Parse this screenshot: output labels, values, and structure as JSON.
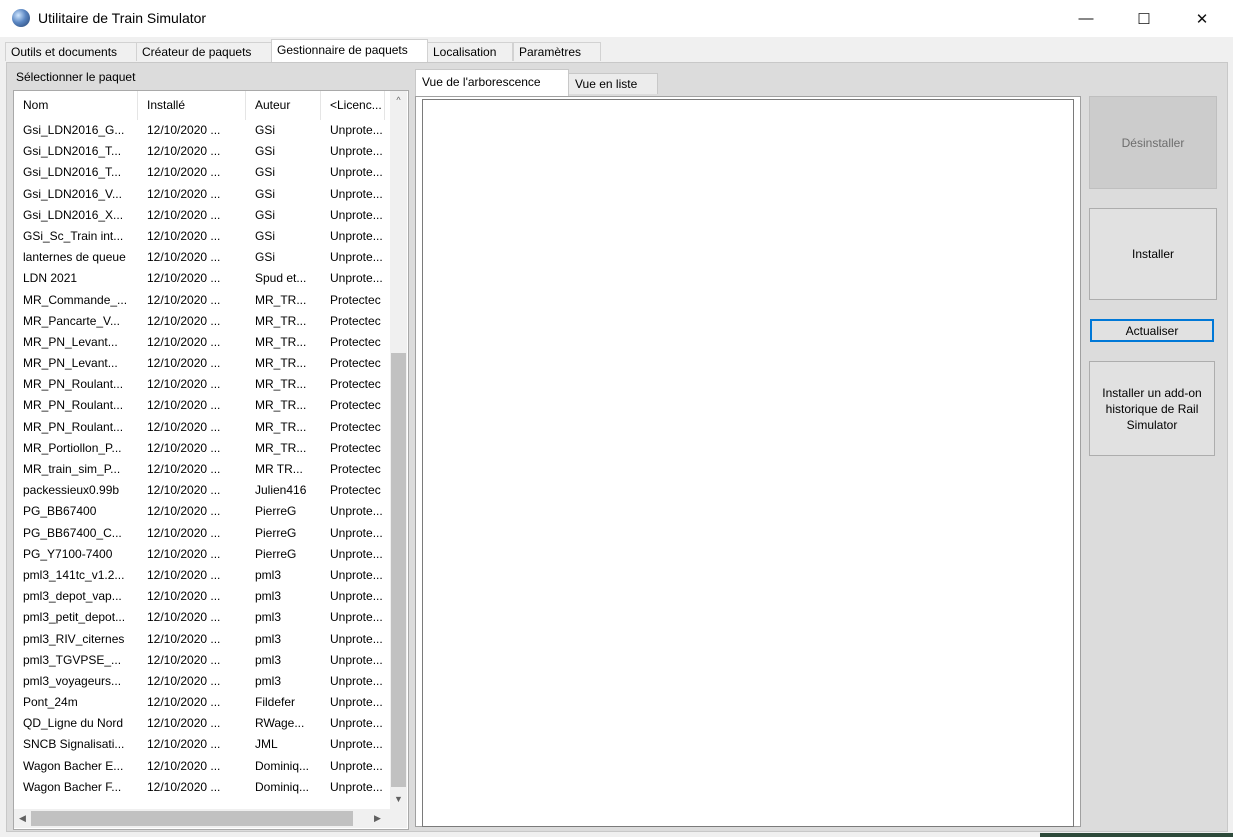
{
  "window": {
    "title": "Utilitaire de Train Simulator",
    "minimize_glyph": "—",
    "maximize_glyph": "☐",
    "close_glyph": "✕"
  },
  "tabs": [
    {
      "label": "Outils et documents"
    },
    {
      "label": "Créateur de paquets"
    },
    {
      "label": "Gestionnaire de paquets",
      "active": true
    },
    {
      "label": "Localisation"
    },
    {
      "label": "Paramètres"
    }
  ],
  "package_panel": {
    "label": "Sélectionner le paquet",
    "columns": [
      "Nom",
      "Installé",
      "Auteur",
      "<Licenc..."
    ],
    "sort_up_glyph": "^",
    "rows": [
      [
        "Gsi_LDN2016_G...",
        "12/10/2020 ...",
        "GSi",
        "Unprote..."
      ],
      [
        "Gsi_LDN2016_T...",
        "12/10/2020 ...",
        "GSi",
        "Unprote..."
      ],
      [
        "Gsi_LDN2016_T...",
        "12/10/2020 ...",
        "GSi",
        "Unprote..."
      ],
      [
        "Gsi_LDN2016_V...",
        "12/10/2020 ...",
        "GSi",
        "Unprote..."
      ],
      [
        "Gsi_LDN2016_X...",
        "12/10/2020 ...",
        "GSi",
        "Unprote..."
      ],
      [
        "GSi_Sc_Train int...",
        "12/10/2020 ...",
        "GSi",
        "Unprote..."
      ],
      [
        "lanternes de queue",
        "12/10/2020 ...",
        "GSi",
        "Unprote..."
      ],
      [
        "LDN 2021",
        "12/10/2020 ...",
        "Spud et...",
        "Unprote..."
      ],
      [
        "MR_Commande_...",
        "12/10/2020 ...",
        "MR_TR...",
        "Protectec"
      ],
      [
        "MR_Pancarte_V...",
        "12/10/2020 ...",
        "MR_TR...",
        "Protectec"
      ],
      [
        "MR_PN_Levant...",
        "12/10/2020 ...",
        "MR_TR...",
        "Protectec"
      ],
      [
        "MR_PN_Levant...",
        "12/10/2020 ...",
        "MR_TR...",
        "Protectec"
      ],
      [
        "MR_PN_Roulant...",
        "12/10/2020 ...",
        "MR_TR...",
        "Protectec"
      ],
      [
        "MR_PN_Roulant...",
        "12/10/2020 ...",
        "MR_TR...",
        "Protectec"
      ],
      [
        "MR_PN_Roulant...",
        "12/10/2020 ...",
        "MR_TR...",
        "Protectec"
      ],
      [
        "MR_Portiollon_P...",
        "12/10/2020 ...",
        "MR_TR...",
        "Protectec"
      ],
      [
        "MR_train_sim_P...",
        "12/10/2020 ...",
        "MR TR...",
        "Protectec"
      ],
      [
        "packessieux0.99b",
        "12/10/2020 ...",
        "Julien416",
        "Protectec"
      ],
      [
        "PG_BB67400",
        "12/10/2020 ...",
        "PierreG",
        "Unprote..."
      ],
      [
        "PG_BB67400_C...",
        "12/10/2020 ...",
        "PierreG",
        "Unprote..."
      ],
      [
        "PG_Y7100-7400",
        "12/10/2020 ...",
        "PierreG",
        "Unprote..."
      ],
      [
        "pml3_141tc_v1.2...",
        "12/10/2020 ...",
        "pml3",
        "Unprote..."
      ],
      [
        "pml3_depot_vap...",
        "12/10/2020 ...",
        "pml3",
        "Unprote..."
      ],
      [
        "pml3_petit_depot...",
        "12/10/2020 ...",
        "pml3",
        "Unprote..."
      ],
      [
        "pml3_RIV_citernes",
        "12/10/2020 ...",
        "pml3",
        "Unprote..."
      ],
      [
        "pml3_TGVPSE_...",
        "12/10/2020 ...",
        "pml3",
        "Unprote..."
      ],
      [
        "pml3_voyageurs...",
        "12/10/2020 ...",
        "pml3",
        "Unprote..."
      ],
      [
        "Pont_24m",
        "12/10/2020 ...",
        "Fildefer",
        "Unprote..."
      ],
      [
        "QD_Ligne du Nord",
        "12/10/2020 ...",
        "RWage...",
        "Unprote..."
      ],
      [
        "SNCB Signalisati...",
        "12/10/2020 ...",
        "JML",
        "Unprote..."
      ],
      [
        "Wagon Bacher E...",
        "12/10/2020 ...",
        "Dominiq...",
        "Unprote..."
      ],
      [
        "Wagon Bacher F...",
        "12/10/2020 ...",
        "Dominiq...",
        "Unprote..."
      ]
    ]
  },
  "view_tabs": [
    {
      "label": "Vue de l'arborescence",
      "active": true
    },
    {
      "label": "Vue en liste"
    }
  ],
  "actions": {
    "uninstall": "Désinstaller",
    "install": "Installer",
    "refresh": "Actualiser",
    "install_legacy": "Installer un add-on historique de Rail Simulator"
  },
  "scroll_glyphs": {
    "up": "▲",
    "down": "▼",
    "left": "◀",
    "right": "▶"
  }
}
